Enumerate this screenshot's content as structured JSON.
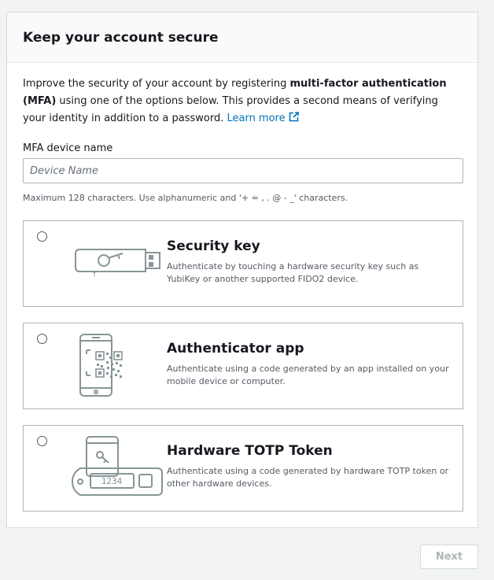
{
  "panel": {
    "title": "Keep your account secure",
    "intro_prefix": "Improve the security of your account by registering ",
    "intro_bold": "multi-factor authentication (MFA)",
    "intro_suffix": " using one of the options below. This provides a second means of verifying your identity in addition to a password. ",
    "learn_more": "Learn more"
  },
  "device_name": {
    "label": "MFA device name",
    "value": "",
    "placeholder": "Device Name",
    "constraint": "Maximum 128 characters. Use alphanumeric and '+ = , . @ - _' characters."
  },
  "options": [
    {
      "title": "Security key",
      "description": "Authenticate by touching a hardware security key such as YubiKey or another supported FIDO2 device.",
      "icon": "usb-security-key-icon",
      "selected": false
    },
    {
      "title": "Authenticator app",
      "description": "Authenticate using a code generated by an app installed on your mobile device or computer.",
      "icon": "phone-qr-code-icon",
      "selected": false
    },
    {
      "title": "Hardware TOTP Token",
      "description": "Authenticate using a code generated by hardware TOTP token or other hardware devices.",
      "icon": "totp-token-icon",
      "selected": false,
      "token_display": "1234"
    }
  ],
  "footer": {
    "next_label": "Next"
  },
  "colors": {
    "link": "#0073bb",
    "border": "#aab7b8",
    "illustration_stroke": "#879596",
    "disabled_text": "#aab7b8"
  }
}
